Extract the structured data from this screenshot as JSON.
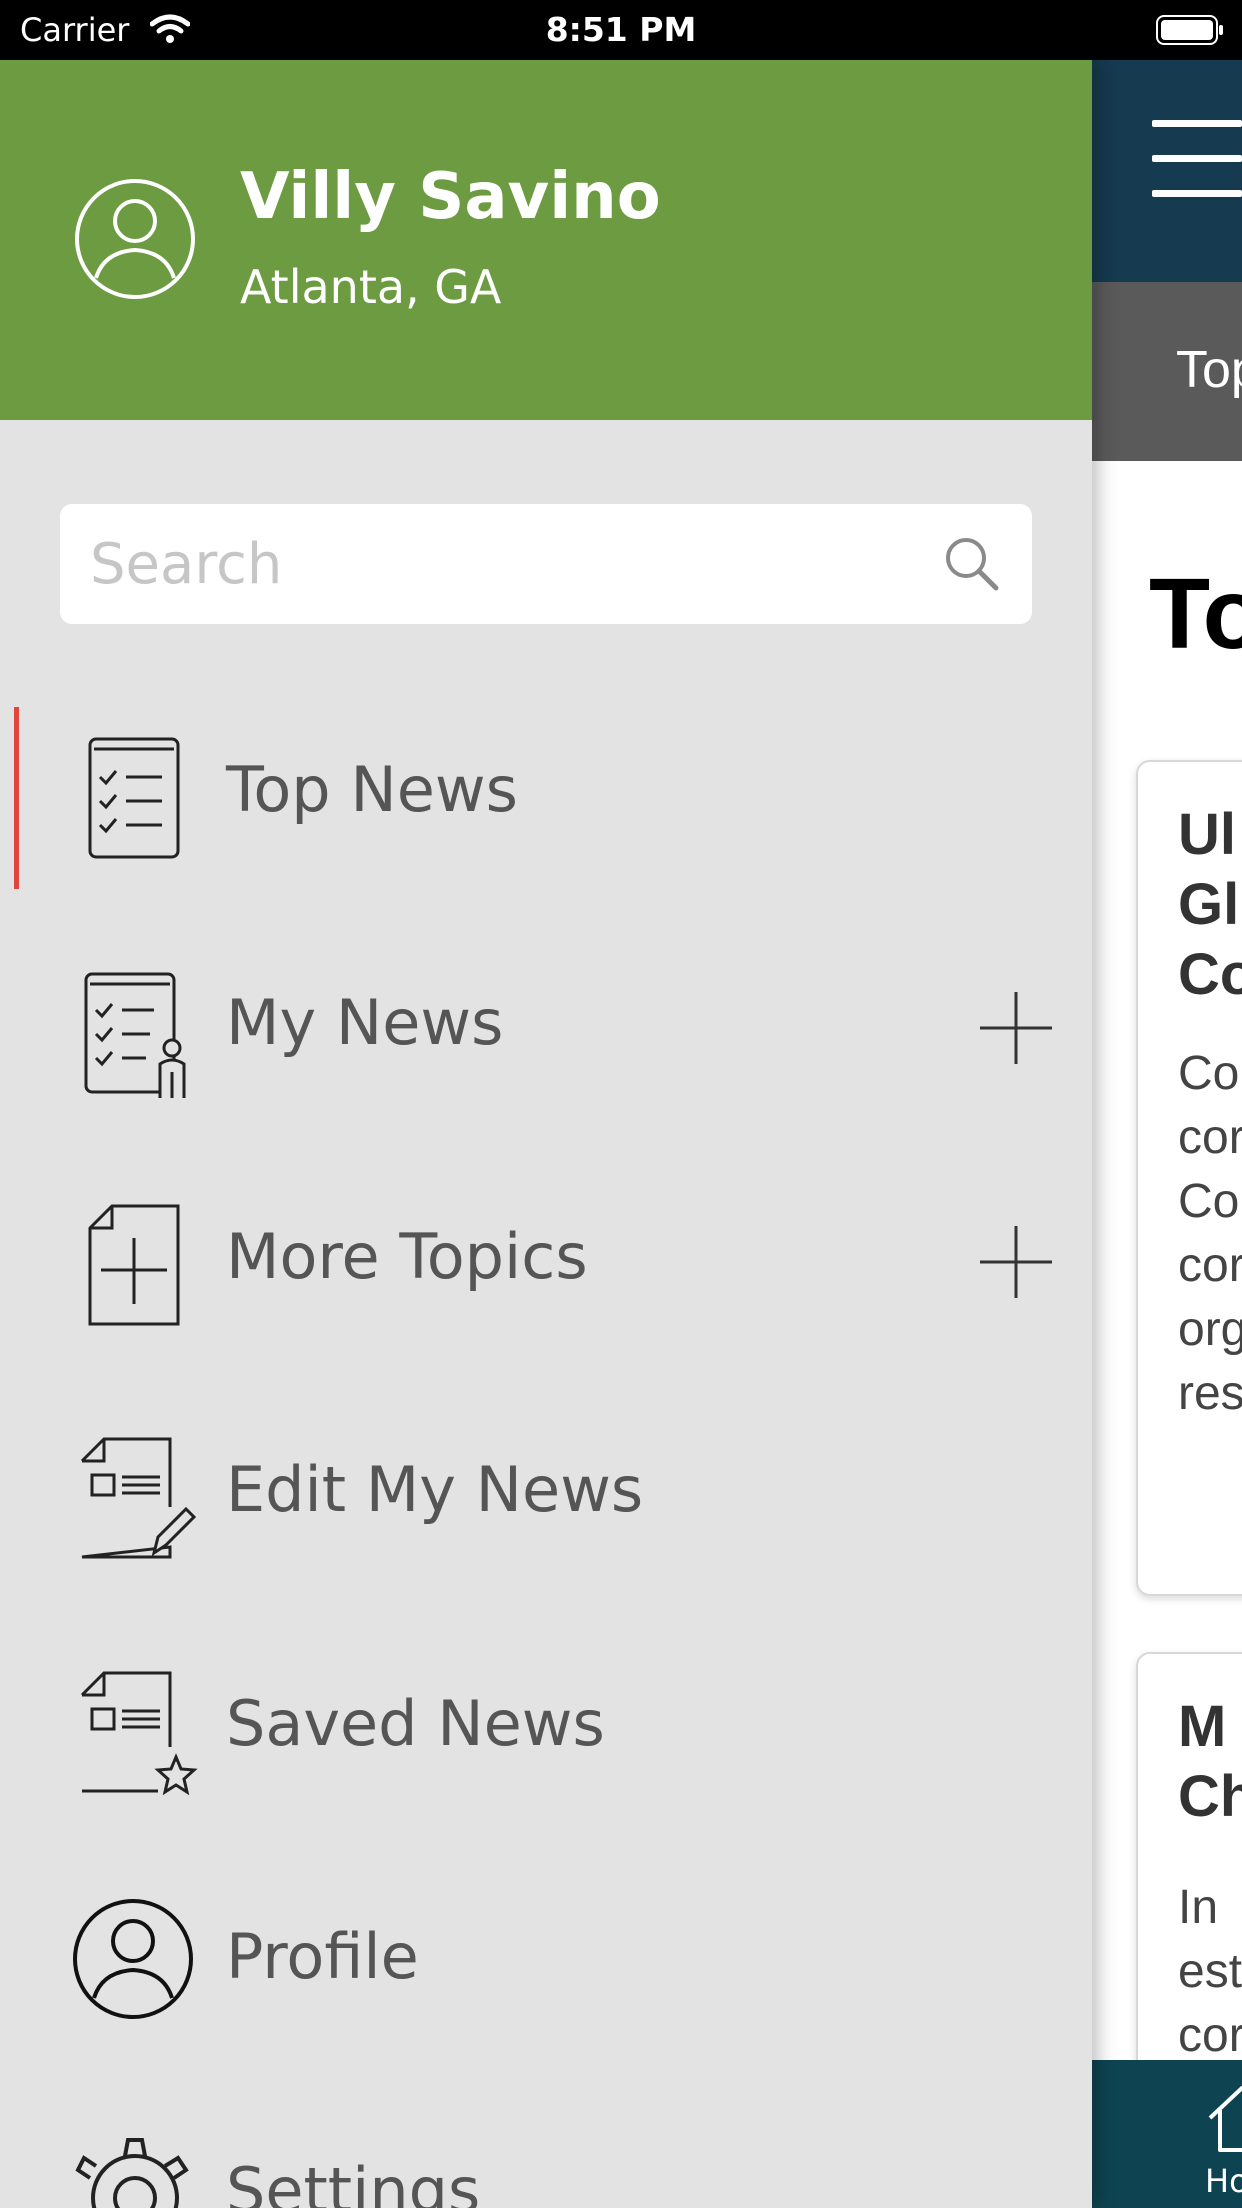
{
  "status_bar": {
    "carrier": "Carrier",
    "time": "8:51 PM",
    "icons": [
      "wifi-icon",
      "battery-icon"
    ]
  },
  "drawer": {
    "user": {
      "name": "Villy Savino",
      "location": "Atlanta, GA"
    },
    "search": {
      "placeholder": "Search"
    },
    "menu": [
      {
        "label": "Top News",
        "icon": "checklist-icon",
        "active": true
      },
      {
        "label": "My News",
        "icon": "checklist-person-icon",
        "expandable": true
      },
      {
        "label": "More Topics",
        "icon": "document-plus-icon",
        "expandable": true
      },
      {
        "label": "Edit My News",
        "icon": "document-edit-icon"
      },
      {
        "label": "Saved News",
        "icon": "document-star-icon"
      },
      {
        "label": "Profile",
        "icon": "user-circle-icon"
      },
      {
        "label": "Settings",
        "icon": "gear-icon"
      }
    ],
    "accent_color": "#6c9b41",
    "active_indicator_color": "#e0463b"
  },
  "main": {
    "tab_label": "Top",
    "page_title": "To",
    "cards": [
      {
        "title_lines": [
          "Ul",
          "Gl",
          "Co"
        ],
        "body_lines": [
          "Co",
          "cor",
          "Co",
          "cor",
          "org",
          "res"
        ]
      },
      {
        "title_lines": [
          "M",
          "Ch"
        ],
        "body_lines": [
          "In",
          "est",
          "cor"
        ]
      }
    ],
    "bottom_nav": {
      "home_label": "Ho"
    },
    "header_color": "#163a4f"
  }
}
